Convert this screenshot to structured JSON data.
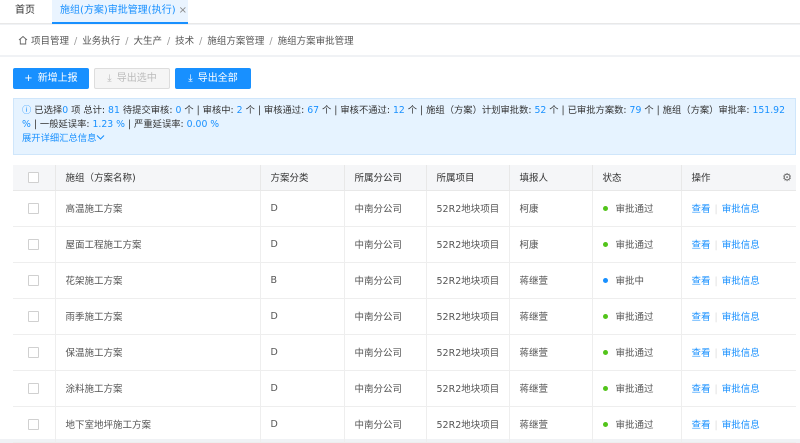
{
  "tabs": {
    "home": "首页",
    "active": "施组(方案)审批管理(执行)",
    "close": "×"
  },
  "breadcrumb": [
    "项目管理",
    "业务执行",
    "大生产",
    "技术",
    "施组方案管理",
    "施组方案审批管理"
  ],
  "toolbar": {
    "add_label": "新增上报",
    "export_selected_label": "导出选中",
    "export_all_label": "导出全部"
  },
  "summary": {
    "selected_prefix": "已选择",
    "selected": "0",
    "selected_suffix": "项 总计:",
    "total": "81",
    "pending_label": "待提交审核:",
    "pending": "0",
    "reviewing_label": "个 | 审核中:",
    "reviewing": "2",
    "passed_label": "个 | 审核通过:",
    "passed": "67",
    "rejected_label": "个 | 审核不通过:",
    "rejected": "12",
    "plan_label": "个 | 施组（方案）计划审批数:",
    "plan": "52",
    "approved_label": "个 | 已审批方案数:",
    "approved": "79",
    "rate_label": "个 | 施组（方案）审批率:",
    "rate": "151.92 %",
    "general_delay_label": "| 一般延误率:",
    "general_delay": "1.23 %",
    "serious_delay_label": "| 严重延误率:",
    "serious_delay": "0.00 %",
    "expand_label": "展开详细汇总信息"
  },
  "table": {
    "headers": [
      "施组（方案名称)",
      "方案分类",
      "所属分公司",
      "所属项目",
      "填报人",
      "状态",
      "操作"
    ],
    "rows": [
      {
        "name": "高温施工方案",
        "category": "D",
        "branch": "中南分公司",
        "project": "52R2地块项目",
        "reporter": "柯康",
        "status": "审批通过",
        "status_color": "#52c41a"
      },
      {
        "name": "屋面工程施工方案",
        "category": "D",
        "branch": "中南分公司",
        "project": "52R2地块项目",
        "reporter": "柯康",
        "status": "审批通过",
        "status_color": "#52c41a"
      },
      {
        "name": "花架施工方案",
        "category": "B",
        "branch": "中南分公司",
        "project": "52R2地块项目",
        "reporter": "蒋继萱",
        "status": "审批中",
        "status_color": "#1890ff"
      },
      {
        "name": "雨季施工方案",
        "category": "D",
        "branch": "中南分公司",
        "project": "52R2地块项目",
        "reporter": "蒋继萱",
        "status": "审批通过",
        "status_color": "#52c41a"
      },
      {
        "name": "保温施工方案",
        "category": "D",
        "branch": "中南分公司",
        "project": "52R2地块项目",
        "reporter": "蒋继萱",
        "status": "审批通过",
        "status_color": "#52c41a"
      },
      {
        "name": "涂料施工方案",
        "category": "D",
        "branch": "中南分公司",
        "project": "52R2地块项目",
        "reporter": "蒋继萱",
        "status": "审批通过",
        "status_color": "#52c41a"
      },
      {
        "name": "地下室地坪施工方案",
        "category": "D",
        "branch": "中南分公司",
        "project": "52R2地块项目",
        "reporter": "蒋继萱",
        "status": "审批通过",
        "status_color": "#52c41a"
      }
    ],
    "actions": {
      "view": "查看",
      "approval_info": "审批信息"
    }
  },
  "colors": {
    "accent": "#1890ff",
    "success": "#52c41a"
  }
}
